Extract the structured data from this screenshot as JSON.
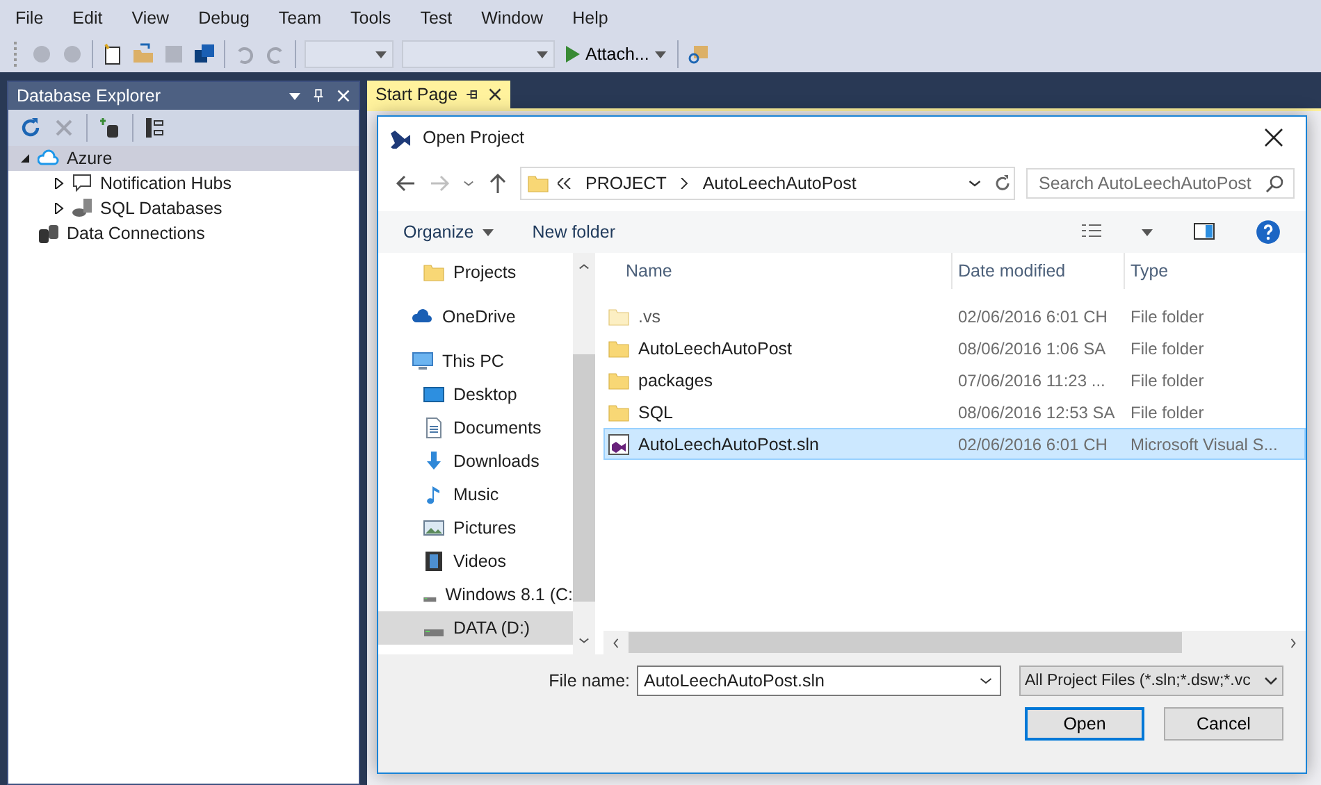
{
  "menu": [
    "File",
    "Edit",
    "View",
    "Debug",
    "Team",
    "Tools",
    "Test",
    "Window",
    "Help"
  ],
  "toolbar": {
    "attach": "Attach..."
  },
  "explorer": {
    "title": "Database Explorer",
    "tree": [
      {
        "label": "Azure",
        "kind": "cloud",
        "expanded": true,
        "selected": true,
        "children": [
          {
            "label": "Notification Hubs",
            "kind": "hub",
            "expanded": false,
            "selected": false
          },
          {
            "label": "SQL Databases",
            "kind": "sql",
            "expanded": false,
            "selected": false
          }
        ]
      },
      {
        "label": "Data Connections",
        "kind": "db",
        "selected": false
      }
    ]
  },
  "tab": {
    "label": "Start Page",
    "selected": true
  },
  "dialog": {
    "title": "Open Project",
    "breadcrumb": [
      "PROJECT",
      "AutoLeechAutoPost"
    ],
    "search": {
      "placeholder": "Search AutoLeechAutoPost"
    },
    "commands": [
      "Organize",
      "New folder"
    ],
    "nav": [
      {
        "label": "Projects",
        "kind": "folder",
        "selected": false
      },
      {
        "label": "OneDrive",
        "kind": "cloud",
        "selected": false
      },
      {
        "label": "This PC",
        "kind": "pc",
        "selected": false
      },
      {
        "label": "Desktop",
        "kind": "desktop",
        "selected": false
      },
      {
        "label": "Documents",
        "kind": "doc",
        "selected": false
      },
      {
        "label": "Downloads",
        "kind": "download",
        "selected": false
      },
      {
        "label": "Music",
        "kind": "music",
        "selected": false
      },
      {
        "label": "Pictures",
        "kind": "pictures",
        "selected": false
      },
      {
        "label": "Videos",
        "kind": "video",
        "selected": false
      },
      {
        "label": "Windows 8.1 (C:",
        "kind": "drive",
        "selected": false
      },
      {
        "label": "DATA (D:)",
        "kind": "drive",
        "selected": true
      }
    ],
    "columns": [
      "Name",
      "Date modified",
      "Type"
    ],
    "rows": [
      {
        "name": ".vs",
        "date": "02/06/2016 6:01 CH",
        "type": "File folder",
        "kind": "folder",
        "hidden": true,
        "selected": false
      },
      {
        "name": "AutoLeechAutoPost",
        "date": "08/06/2016 1:06 SA",
        "type": "File folder",
        "kind": "folder",
        "hidden": false,
        "selected": false
      },
      {
        "name": "packages",
        "date": "07/06/2016 11:23 ...",
        "type": "File folder",
        "kind": "folder",
        "hidden": false,
        "selected": false
      },
      {
        "name": "SQL",
        "date": "08/06/2016 12:53 SA",
        "type": "File folder",
        "kind": "folder",
        "hidden": false,
        "selected": false
      },
      {
        "name": "AutoLeechAutoPost.sln",
        "date": "02/06/2016 6:01 CH",
        "type": "Microsoft Visual S...",
        "kind": "solution",
        "hidden": false,
        "selected": true
      }
    ],
    "file_name": {
      "label": "File name:",
      "value": "AutoLeechAutoPost.sln"
    },
    "filter": "All Project Files (*.sln;*.dsw;*.vc",
    "buttons": [
      {
        "label": "Open",
        "default": true
      },
      {
        "label": "Cancel",
        "default": false
      }
    ]
  }
}
